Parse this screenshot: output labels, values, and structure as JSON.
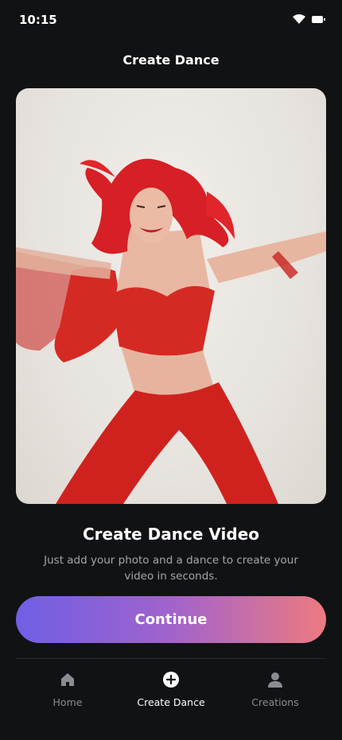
{
  "status_bar": {
    "time": "10:15"
  },
  "header": {
    "title": "Create Dance"
  },
  "hero_image": {
    "description_icon": "dancer-photo"
  },
  "main": {
    "title": "Create Dance Video",
    "subtitle": "Just add your photo and a dance to create your video in seconds."
  },
  "continue_button": {
    "label": "Continue"
  },
  "bottom_nav": {
    "items": [
      {
        "label": "Home",
        "icon": "home-icon",
        "active": false
      },
      {
        "label": "Create Dance",
        "icon": "plus-circle-icon",
        "active": true
      },
      {
        "label": "Creations",
        "icon": "person-icon",
        "active": false
      }
    ]
  },
  "colors": {
    "background": "#111214",
    "button_gradient_start": "#6f5fe4",
    "button_gradient_end": "#ee7a80",
    "muted_text": "#a4a6ad",
    "nav_inactive": "#8a8c93"
  }
}
